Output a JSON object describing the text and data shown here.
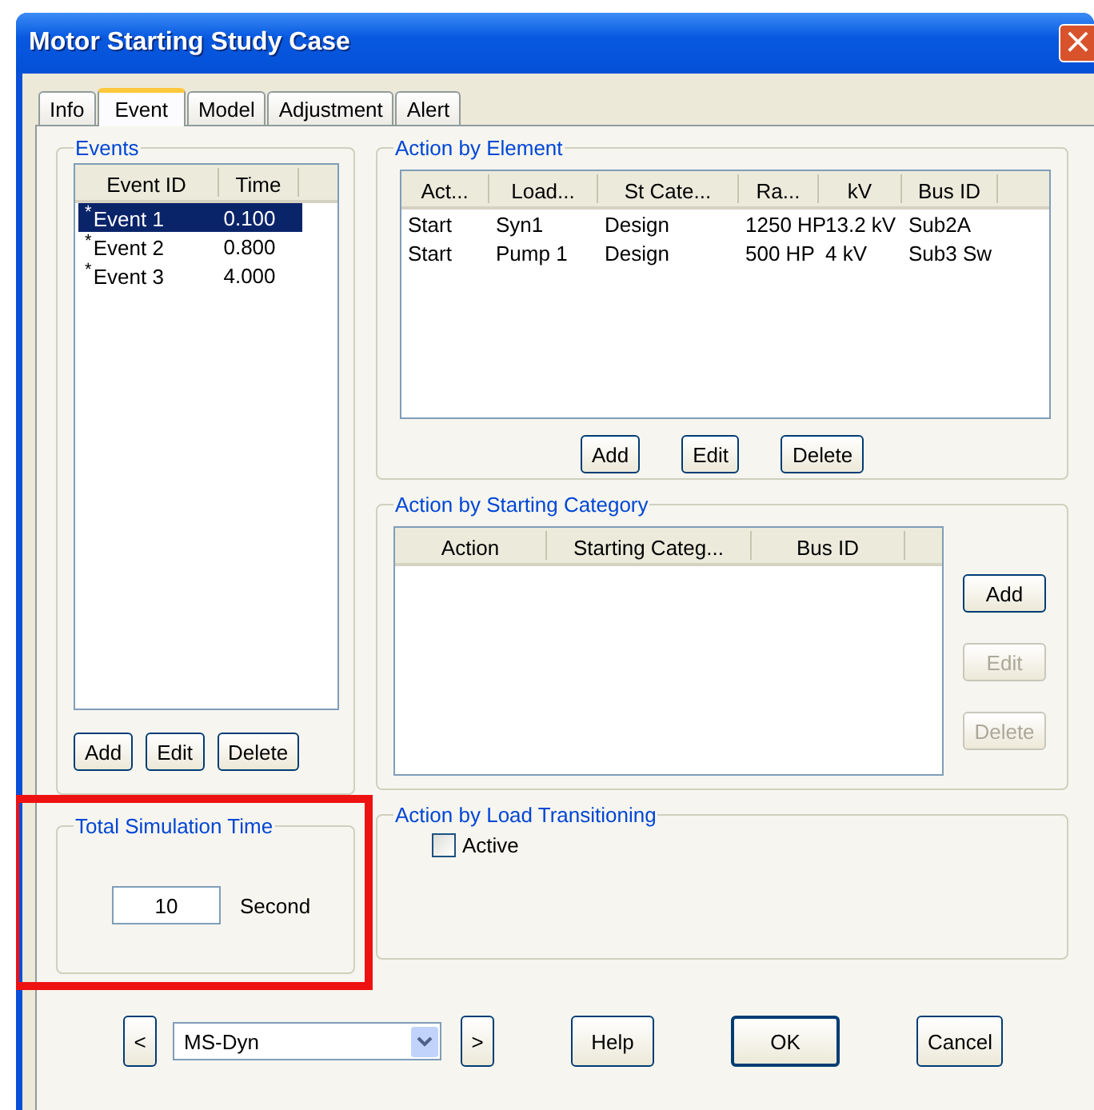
{
  "window": {
    "title": "Motor Starting Study Case",
    "close_icon": "×"
  },
  "tabs": [
    {
      "label": "Info",
      "selected": false
    },
    {
      "label": "Event",
      "selected": true
    },
    {
      "label": "Model",
      "selected": false
    },
    {
      "label": "Adjustment",
      "selected": false
    },
    {
      "label": "Alert",
      "selected": false
    }
  ],
  "events": {
    "title": "Events",
    "columns": [
      "Event ID",
      "Time"
    ],
    "rows": [
      {
        "marker": "*",
        "id": "Event 1",
        "time": "0.100",
        "selected": true
      },
      {
        "marker": "*",
        "id": "Event 2",
        "time": "0.800",
        "selected": false
      },
      {
        "marker": "*",
        "id": "Event 3",
        "time": "4.000",
        "selected": false
      }
    ],
    "buttons": [
      {
        "label": "Add",
        "disabled": false
      },
      {
        "label": "Edit",
        "disabled": false
      },
      {
        "label": "Delete",
        "disabled": false
      }
    ]
  },
  "action_by_element": {
    "title": "Action by Element",
    "columns": [
      "Act...",
      "Load...",
      "St Cate...",
      "Ra...",
      "kV",
      "Bus ID"
    ],
    "rows": [
      [
        "Start",
        "Syn1",
        "Design",
        "1250 HP",
        "13.2 kV",
        "Sub2A"
      ],
      [
        "Start",
        "Pump 1",
        "Design",
        "500 HP",
        "4 kV",
        "Sub3 Sw"
      ]
    ],
    "buttons": [
      {
        "label": "Add",
        "disabled": false
      },
      {
        "label": "Edit",
        "disabled": false
      },
      {
        "label": "Delete",
        "disabled": false
      }
    ]
  },
  "action_by_starting_category": {
    "title": "Action by Starting Category",
    "columns": [
      "Action",
      "Starting Categ...",
      "Bus ID"
    ],
    "buttons": [
      {
        "label": "Add",
        "disabled": false
      },
      {
        "label": "Edit",
        "disabled": true
      },
      {
        "label": "Delete",
        "disabled": true
      }
    ]
  },
  "total_simulation_time": {
    "title": "Total Simulation Time",
    "value": "10",
    "unit": "Second",
    "highlighted": true
  },
  "action_by_load_transitioning": {
    "title": "Action by Load Transitioning",
    "active": {
      "label": "Active",
      "checked": false
    }
  },
  "footer": {
    "prev": "<",
    "study_case": "MS-Dyn",
    "next": ">",
    "buttons": [
      {
        "label": "Help",
        "default": false
      },
      {
        "label": "OK",
        "default": true
      },
      {
        "label": "Cancel",
        "default": false
      }
    ]
  }
}
